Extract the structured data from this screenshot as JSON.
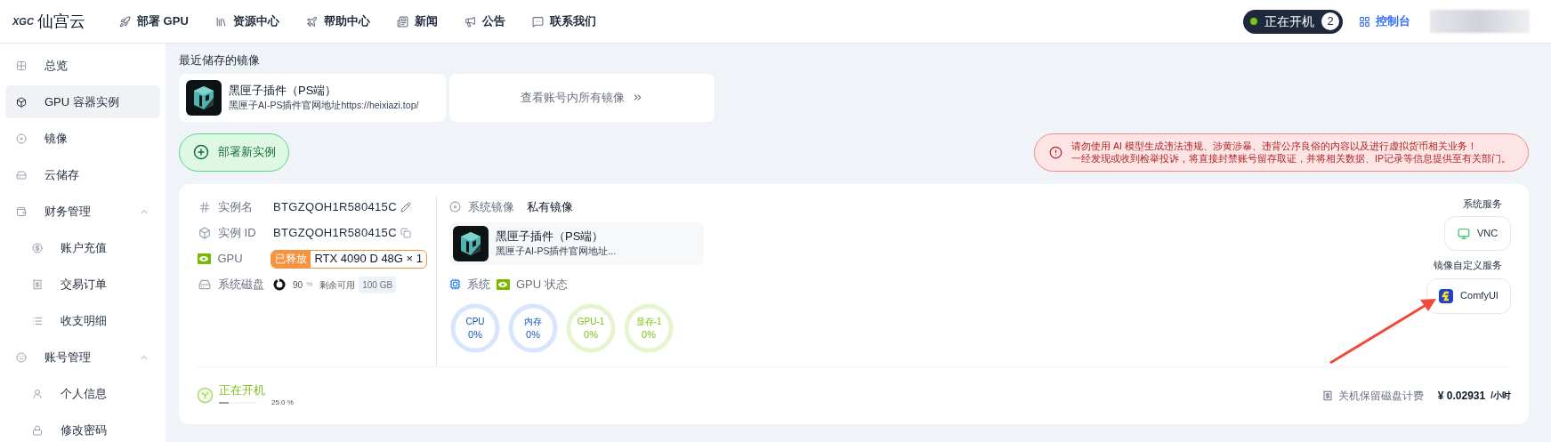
{
  "header": {
    "logo_mark": "XGC",
    "logo_text": "仙宫云",
    "nav": [
      "部署 GPU",
      "资源中心",
      "帮助中心",
      "新闻",
      "公告",
      "联系我们"
    ],
    "running": {
      "label": "正在开机",
      "count": "2"
    },
    "console": "控制台"
  },
  "sidebar": {
    "items": [
      {
        "label": "总览",
        "selected": false
      },
      {
        "label": "GPU 容器实例",
        "selected": true
      },
      {
        "label": "镜像",
        "selected": false
      },
      {
        "label": "云储存",
        "selected": false
      },
      {
        "label": "财务管理",
        "selected": false,
        "expanded": true,
        "children": [
          {
            "label": "账户充值",
            "selected": false
          },
          {
            "label": "交易订单",
            "selected": false
          },
          {
            "label": "收支明细",
            "selected": false
          }
        ]
      },
      {
        "label": "账号管理",
        "selected": false,
        "expanded": true,
        "children": [
          {
            "label": "个人信息",
            "selected": false
          },
          {
            "label": "修改密码",
            "selected": false
          }
        ]
      }
    ]
  },
  "recent": {
    "title": "最近储存的镜像",
    "image": {
      "name": "黑匣子插件（PS端）",
      "description": "黑匣子AI-PS插件官网地址https://heixiazi.top/"
    },
    "view_all": "查看账号内所有镜像"
  },
  "deploy_button": "部署新实例",
  "warning": [
    "请勿使用 AI 模型生成违法违规、涉黄涉暴、违背公序良俗的内容以及进行虚拟货币相关业务！",
    "一经发现或收到检举投诉，将直接封禁账号留存取证，并将相关数据、IP记录等信息提供至有关部门。"
  ],
  "instance": {
    "fields": [
      {
        "kind": "name",
        "label": "实例名",
        "value": "BTGZQOH1R580415C"
      },
      {
        "kind": "id",
        "label": "实例 ID",
        "value": "BTGZQOH1R580415C"
      },
      {
        "kind": "gpu",
        "label": "GPU",
        "badge": "已释放",
        "value": "RTX 4090 D 48G × 1"
      },
      {
        "kind": "disk",
        "label": "系统磁盘",
        "percent": "90",
        "unit": "%",
        "free_label": "剩余可用",
        "free": "100 GB"
      }
    ],
    "image_section": {
      "label": "系统镜像",
      "type": "私有镜像",
      "name": "黑匣子插件（PS端）",
      "description": "黑匣子AI-PS插件官网地址..."
    },
    "status_section": {
      "label_system": "系统",
      "label_gpu": "GPU 状态",
      "gauges": [
        {
          "label": "CPU",
          "value": "0%",
          "color": "#d8e6fd"
        },
        {
          "label": "内存",
          "value": "0%",
          "color": "#d8e6fd"
        },
        {
          "label": "GPU-1",
          "value": "0%",
          "color": "#e6f5cf"
        },
        {
          "label": "显存-1",
          "value": "0%",
          "color": "#e6f5cf"
        }
      ]
    },
    "services": {
      "system_label": "系统服务",
      "system": [
        "VNC"
      ],
      "custom_label": "镜像自定义服务",
      "custom": [
        "ComfyUI"
      ]
    },
    "status": {
      "label": "正在开机",
      "level": 0.25,
      "percent": "25.0 %"
    },
    "billing": {
      "label": "关机保留磁盘计费",
      "price": "¥ 0.02931",
      "unit": "/小时"
    }
  }
}
